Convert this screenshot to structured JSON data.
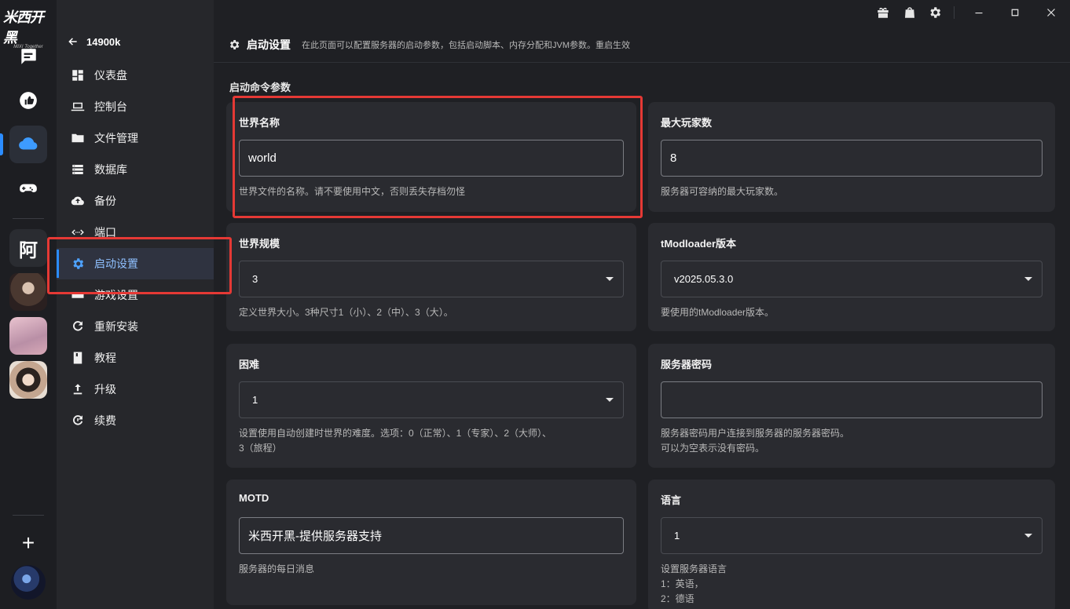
{
  "app": {
    "logo_text": "米西开黑",
    "logo_sub": "MIXI Together"
  },
  "rail": {
    "text_avatar": "阿",
    "plus": "+"
  },
  "sidebar": {
    "server_name": "14900k",
    "items": [
      {
        "label": "仪表盘",
        "icon": "dashboard-icon"
      },
      {
        "label": "控制台",
        "icon": "laptop-icon"
      },
      {
        "label": "文件管理",
        "icon": "folder-icon"
      },
      {
        "label": "数据库",
        "icon": "database-icon"
      },
      {
        "label": "备份",
        "icon": "cloud-upload-icon"
      },
      {
        "label": "端口",
        "icon": "code-icon"
      },
      {
        "label": "启动设置",
        "icon": "gear-icon"
      },
      {
        "label": "游戏设置",
        "icon": "gamepad-icon"
      },
      {
        "label": "重新安装",
        "icon": "refresh-icon"
      },
      {
        "label": "教程",
        "icon": "book-icon"
      },
      {
        "label": "升级",
        "icon": "upgrade-icon"
      },
      {
        "label": "续费",
        "icon": "renew-icon"
      }
    ],
    "active_index": 6
  },
  "header": {
    "title": "启动设置",
    "description": "在此页面可以配置服务器的启动参数，包括启动脚本、内存分配和JVM参数。重启生效"
  },
  "content": {
    "section_title": "启动命令参数",
    "fields": {
      "world_name": {
        "label": "世界名称",
        "value": "world",
        "help": "世界文件的名称。请不要使用中文，否则丢失存档勿怪"
      },
      "max_players": {
        "label": "最大玩家数",
        "value": "8",
        "help": "服务器可容纳的最大玩家数。"
      },
      "world_size": {
        "label": "世界规模",
        "value": "3",
        "help": "定义世界大小。3种尺寸1（小）、2（中）、3（大）。"
      },
      "tmod_version": {
        "label": "tModloader版本",
        "value": "v2025.05.3.0",
        "help": "要使用的tModloader版本。"
      },
      "difficulty": {
        "label": "困难",
        "value": "1",
        "help": "设置使用自动创建时世界的难度。选项：0（正常）、1（专家）、2（大师）、\n3（旅程）"
      },
      "password": {
        "label": "服务器密码",
        "value": "",
        "help": "服务器密码用户连接到服务器的服务器密码。\n可以为空表示没有密码。"
      },
      "motd": {
        "label": "MOTD",
        "value": "米西开黑-提供服务器支持",
        "help": "服务器的每日消息"
      },
      "language": {
        "label": "语言",
        "value": "1",
        "help": "设置服务器语言\n1：英语，\n2：德语"
      }
    }
  },
  "colors": {
    "accent": "#2b8cff",
    "highlight_box": "#e53935"
  }
}
